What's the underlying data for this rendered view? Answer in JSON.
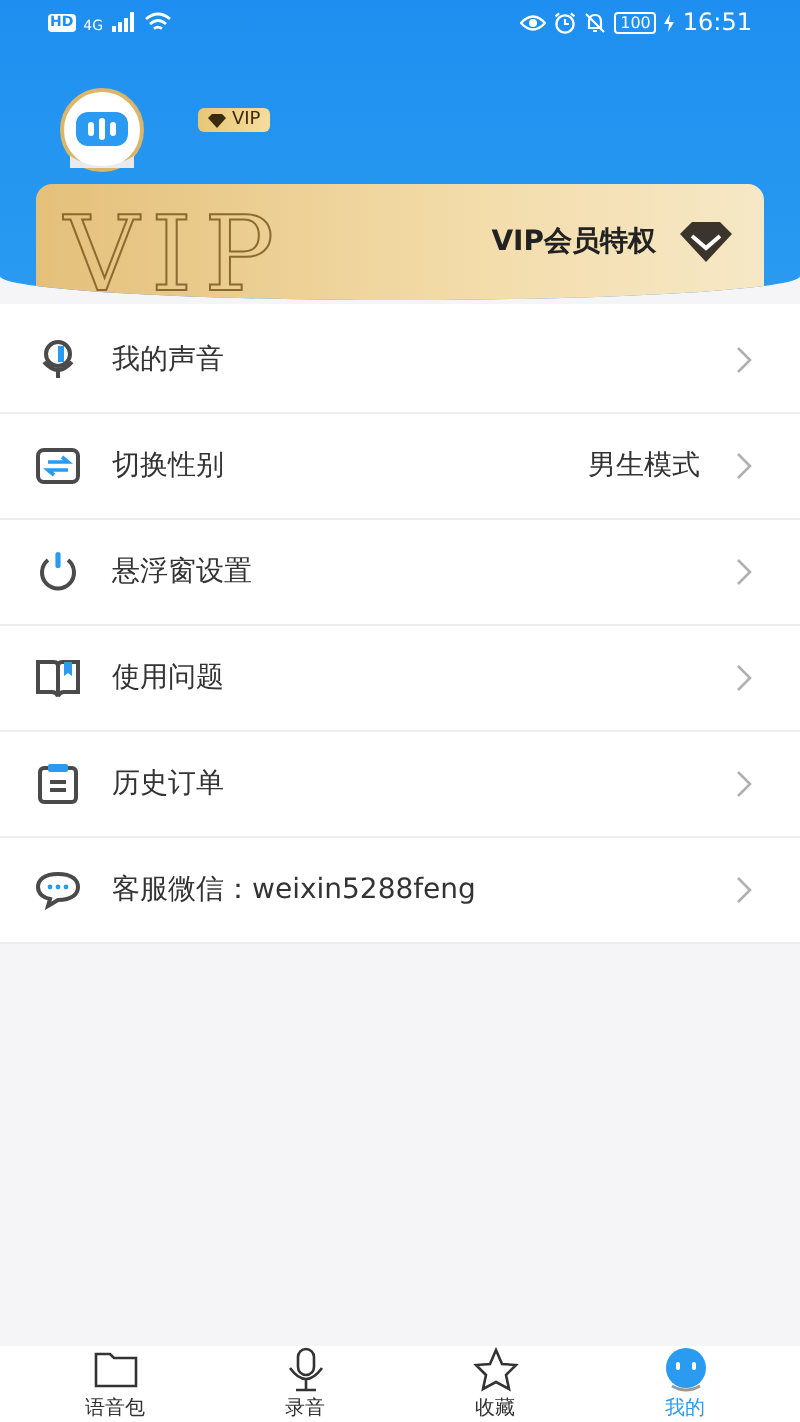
{
  "status_bar": {
    "network_badge": "HD",
    "network_type": "4G",
    "battery": "100",
    "time": "16:51"
  },
  "profile": {
    "vip_badge": "VIP"
  },
  "vip_card": {
    "watermark": "VIP",
    "title": "VIP会员特权"
  },
  "menu": [
    {
      "kind": "voice",
      "label": "我的声音"
    },
    {
      "kind": "switch",
      "label": "切换性别",
      "value": "男生模式"
    },
    {
      "kind": "power",
      "label": "悬浮窗设置"
    },
    {
      "kind": "book",
      "label": "使用问题"
    },
    {
      "kind": "order",
      "label": "历史订单"
    },
    {
      "kind": "chat",
      "label": "客服微信：weixin5288feng"
    }
  ],
  "tab_bar": [
    {
      "kind": "folder",
      "label": "语音包",
      "selected": false
    },
    {
      "kind": "mic",
      "label": "录音",
      "selected": false
    },
    {
      "kind": "star",
      "label": "收藏",
      "selected": false
    },
    {
      "kind": "robot",
      "label": "我的",
      "selected": true
    }
  ]
}
